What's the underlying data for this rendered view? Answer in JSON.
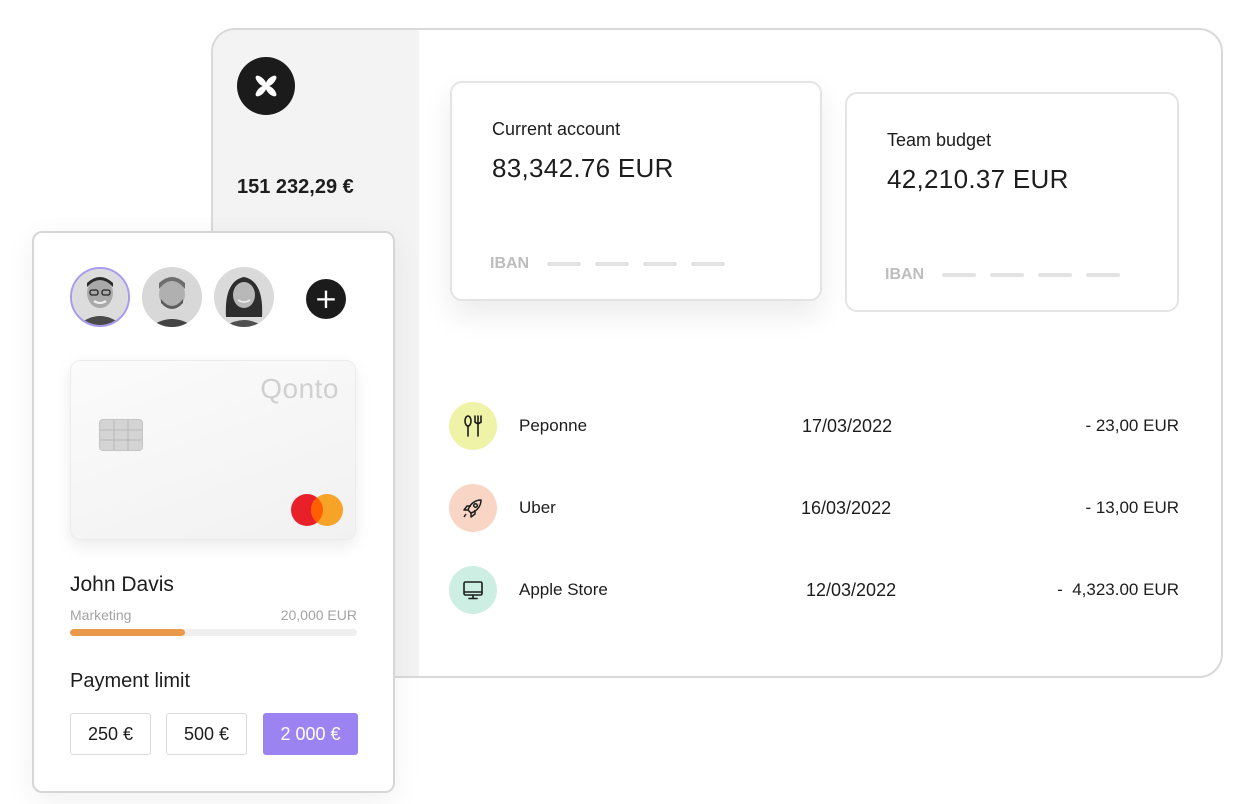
{
  "sidebar": {
    "logo_icon": "qonto-logo-icon",
    "balance": "151 232,29 €"
  },
  "accounts": [
    {
      "name": "Current account",
      "amount": "83,342.76 EUR",
      "iban_label": "IBAN"
    },
    {
      "name": "Team budget",
      "amount": "42,210.37 EUR",
      "iban_label": "IBAN"
    }
  ],
  "transactions": [
    {
      "icon": "fork-knife-icon",
      "icon_bg": "#eef3a8",
      "name": "Peponne",
      "date": "17/03/2022",
      "amount": "- 23,00 EUR"
    },
    {
      "icon": "rocket-icon",
      "icon_bg": "#f9d5c6",
      "name": "Uber",
      "date": "16/03/2022",
      "amount": "- 13,00 EUR"
    },
    {
      "icon": "monitor-icon",
      "icon_bg": "#cdeee2",
      "name": "Apple Store",
      "date": "12/03/2022",
      "amount": "-  4,323.00 EUR"
    }
  ],
  "card_panel": {
    "members": [
      "avatar-man-glasses",
      "avatar-man-beard",
      "avatar-woman"
    ],
    "add_member_label": "+",
    "card_brand": "Qonto",
    "cardholder": "John Davis",
    "department": "Marketing",
    "budget": "20,000 EUR",
    "budget_used_fraction": 0.4,
    "payment_limit_title": "Payment limit",
    "limit_options": [
      "250 €",
      "500 €",
      "2 000 €"
    ],
    "selected_limit": "2 000 €"
  },
  "colors": {
    "accent_purple": "#9b84f2",
    "progress_orange": "#e89a4a",
    "dark": "#1b1b1b"
  }
}
